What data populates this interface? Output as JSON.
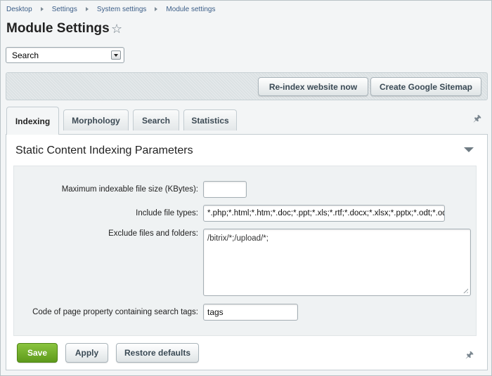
{
  "breadcrumb": {
    "items": [
      "Desktop",
      "Settings",
      "System settings",
      "Module settings"
    ]
  },
  "header": {
    "title": "Module Settings",
    "star_icon": "star-outline-icon"
  },
  "module_select": {
    "selected": "Search"
  },
  "toolbar": {
    "reindex_label": "Re-index website now",
    "sitemap_label": "Create Google Sitemap"
  },
  "tabs": [
    {
      "label": "Indexing",
      "active": true
    },
    {
      "label": "Morphology",
      "active": false
    },
    {
      "label": "Search",
      "active": false
    },
    {
      "label": "Statistics",
      "active": false
    }
  ],
  "section": {
    "title": "Static Content Indexing Parameters"
  },
  "form": {
    "max_size_label": "Maximum indexable file size (KBytes):",
    "max_size_value": "",
    "include_label": "Include file types:",
    "include_value": "*.php;*.html;*.htm;*.doc;*.ppt;*.xls;*.rtf;*.docx;*.xlsx;*.pptx;*.odt;*.odp",
    "exclude_label": "Exclude files and folders:",
    "exclude_value": "/bitrix/*;/upload/*;",
    "tags_label": "Code of page property containing search tags:",
    "tags_value": "tags"
  },
  "footer": {
    "save_label": "Save",
    "apply_label": "Apply",
    "restore_label": "Restore defaults"
  },
  "colors": {
    "save_green": "#6aa826",
    "link_blue": "#3b5d87"
  }
}
